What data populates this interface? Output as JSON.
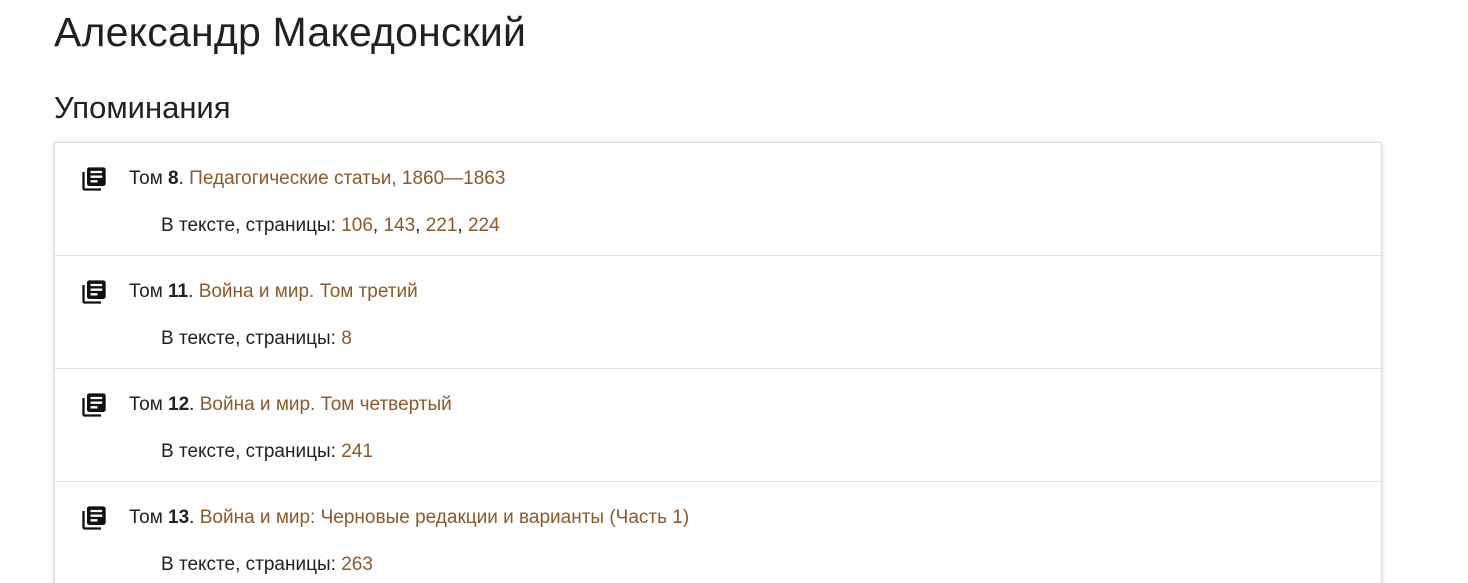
{
  "header": {
    "title": "Александр Македонский"
  },
  "section": {
    "title": "Упоминания"
  },
  "mentions": [
    {
      "vol_prefix": "Том ",
      "vol_num": "8",
      "separator": ". ",
      "work_title": "Педагогические статьи, 1860—1863",
      "pages_label": "В тексте, страницы: ",
      "pages": [
        "106",
        "143",
        "221",
        "224"
      ]
    },
    {
      "vol_prefix": "Том ",
      "vol_num": "11",
      "separator": ". ",
      "work_title": "Война и мир. Том третий",
      "pages_label": "В тексте, страницы: ",
      "pages": [
        "8"
      ]
    },
    {
      "vol_prefix": "Том ",
      "vol_num": "12",
      "separator": ". ",
      "work_title": "Война и мир. Том четвертый",
      "pages_label": "В тексте, страницы: ",
      "pages": [
        "241"
      ]
    },
    {
      "vol_prefix": "Том ",
      "vol_num": "13",
      "separator": ". ",
      "work_title": "Война и мир: Черновые редакции и варианты (Часть 1)",
      "pages_label": "В тексте, страницы: ",
      "pages": [
        "263"
      ]
    }
  ],
  "page_separator": ", ",
  "icons": {
    "mention": "library-books-icon"
  },
  "colors": {
    "link": "#8a5a2b",
    "text": "#212121"
  }
}
